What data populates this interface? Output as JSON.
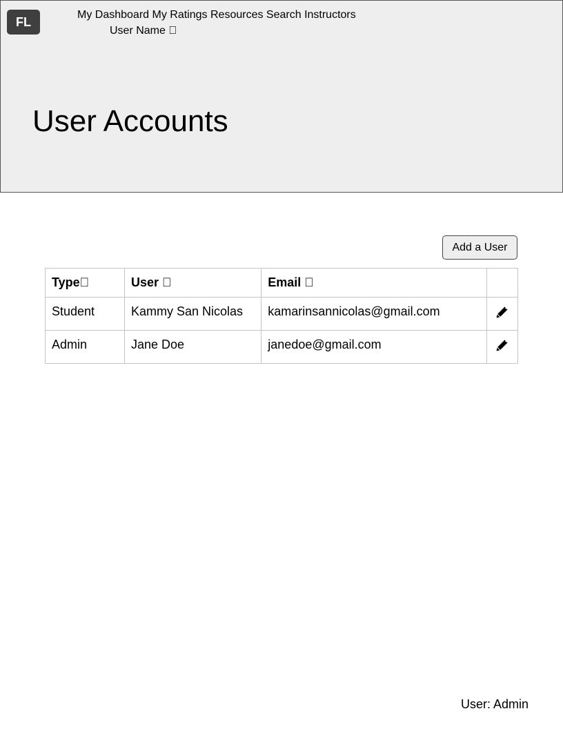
{
  "header": {
    "logo": "FL",
    "nav": [
      "My Dashboard",
      "My Ratings",
      "Resources",
      "Search Instructors"
    ],
    "user_menu": "User Name "
  },
  "hero": {
    "title": "User Accounts"
  },
  "actions": {
    "add_user_label": "Add a User"
  },
  "table": {
    "columns": [
      "Type",
      "User ",
      "Email ",
      ""
    ],
    "rows": [
      {
        "type": "Student",
        "user": "Kammy San Nicolas",
        "email": "kamarinsannicolas@gmail.com",
        "action_icon": "pencil-icon"
      },
      {
        "type": "Admin",
        "user": "Jane Doe",
        "email": "janedoe@gmail.com",
        "action_icon": "pencil-icon"
      }
    ]
  },
  "footer": {
    "user_label": "User: Admin"
  },
  "colors": {
    "header_bg": "#eeeeee",
    "logo_bg": "#3f3f3f",
    "border": "#555555",
    "table_border": "#c4c4c4"
  }
}
